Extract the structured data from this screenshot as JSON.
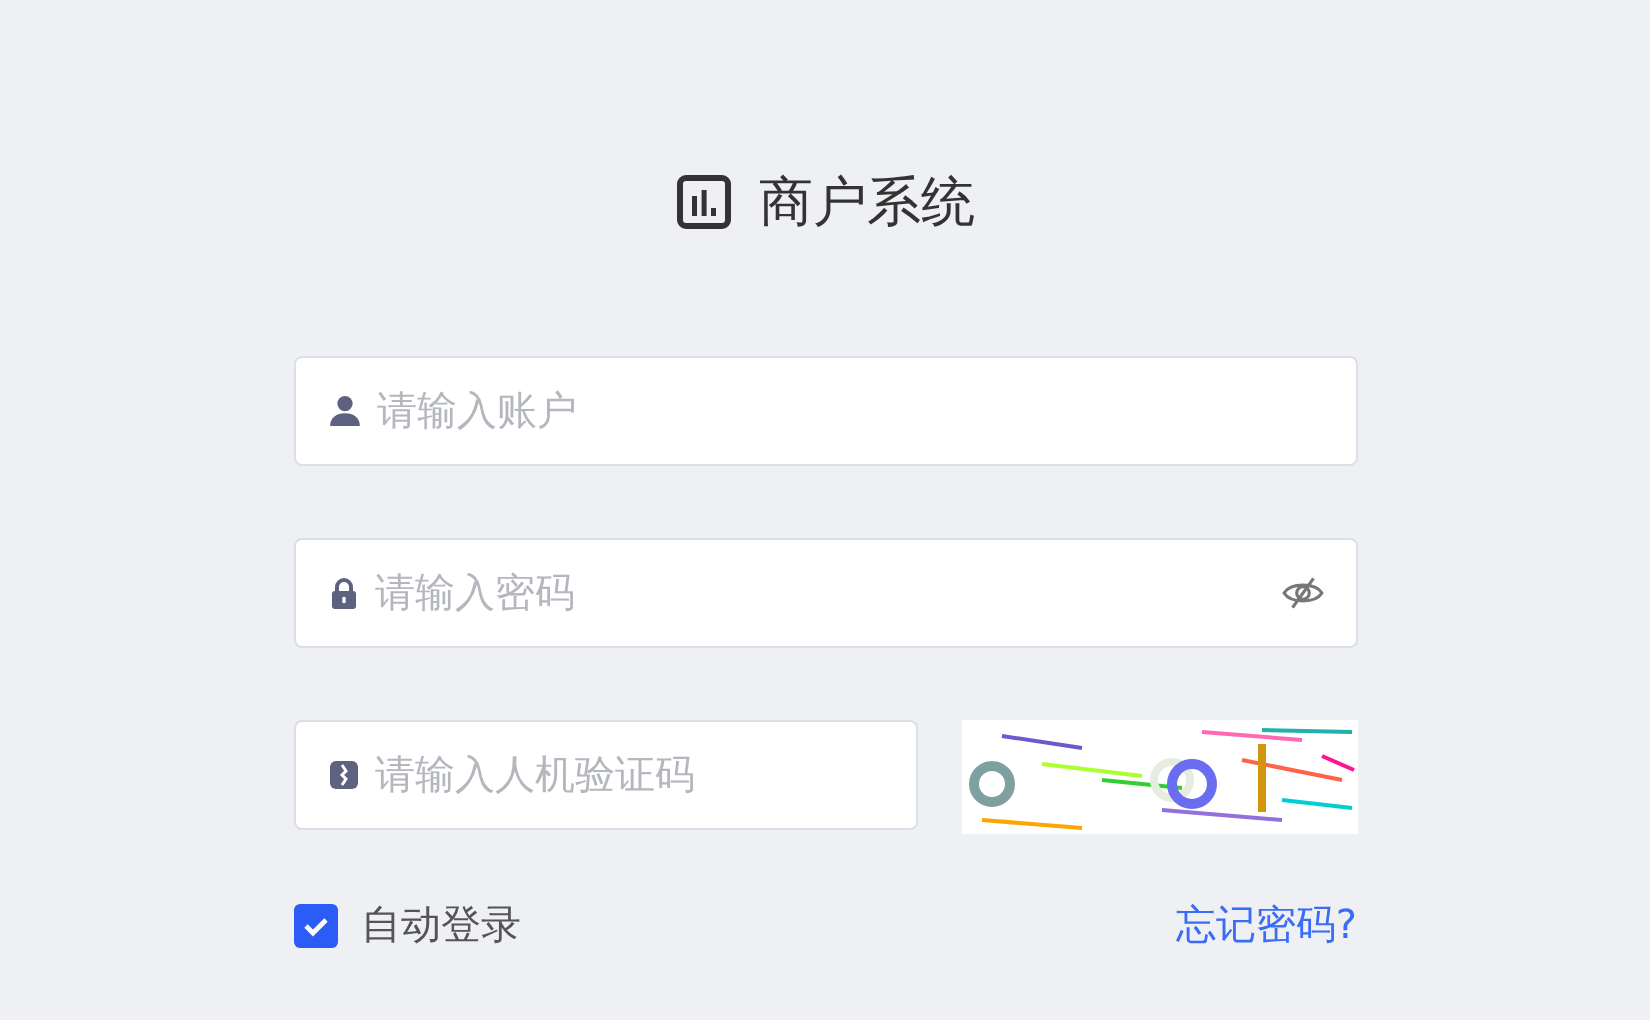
{
  "title": "商户系统",
  "fields": [
    {
      "kind": "account",
      "placeholder": "请输入账户"
    },
    {
      "kind": "password",
      "placeholder": "请输入密码"
    },
    {
      "kind": "captcha",
      "placeholder": "请输入人机验证码"
    }
  ],
  "remember": {
    "label": "自动登录",
    "checked": true
  },
  "forgot_link": "忘记密码?"
}
